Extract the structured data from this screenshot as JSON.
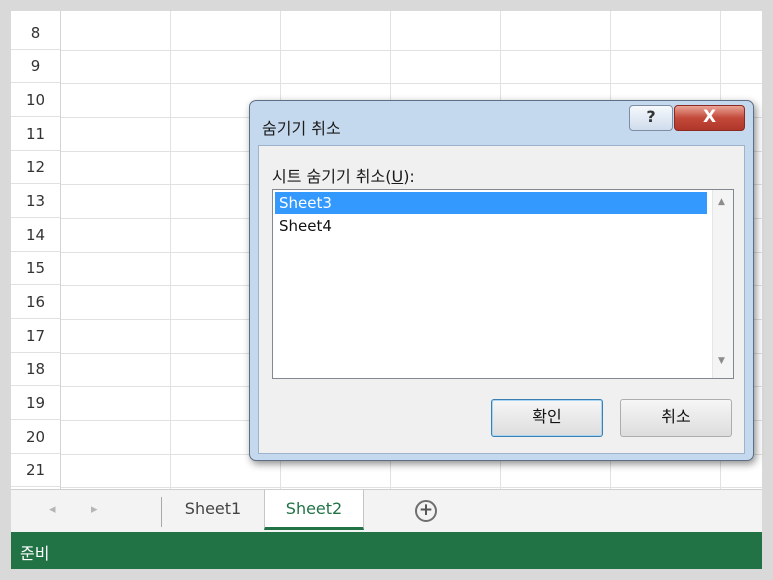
{
  "grid": {
    "rows": [
      "8",
      "9",
      "10",
      "11",
      "12",
      "13",
      "14",
      "15",
      "16",
      "17",
      "18",
      "19",
      "20",
      "21"
    ]
  },
  "sheet_tabs": {
    "nav_prev": "◂",
    "nav_next": "▸",
    "tabs": [
      "Sheet1",
      "Sheet2"
    ],
    "active_tab": "Sheet2",
    "add_symbol": "+"
  },
  "status_bar": {
    "text": "준비"
  },
  "dialog": {
    "title": "숨기기 취소",
    "help_symbol": "?",
    "close_symbol": "X",
    "label_prefix": "시트 숨기기 취소(",
    "label_accel": "U",
    "label_suffix": "):",
    "items": [
      "Sheet3",
      "Sheet4"
    ],
    "selected_item": "Sheet3",
    "scroll_up": "▲",
    "scroll_down": "▼",
    "ok_label": "확인",
    "cancel_label": "취소"
  },
  "colors": {
    "accent_green": "#217346",
    "selection_blue": "#3399ff",
    "close_red": "#c3493a"
  }
}
